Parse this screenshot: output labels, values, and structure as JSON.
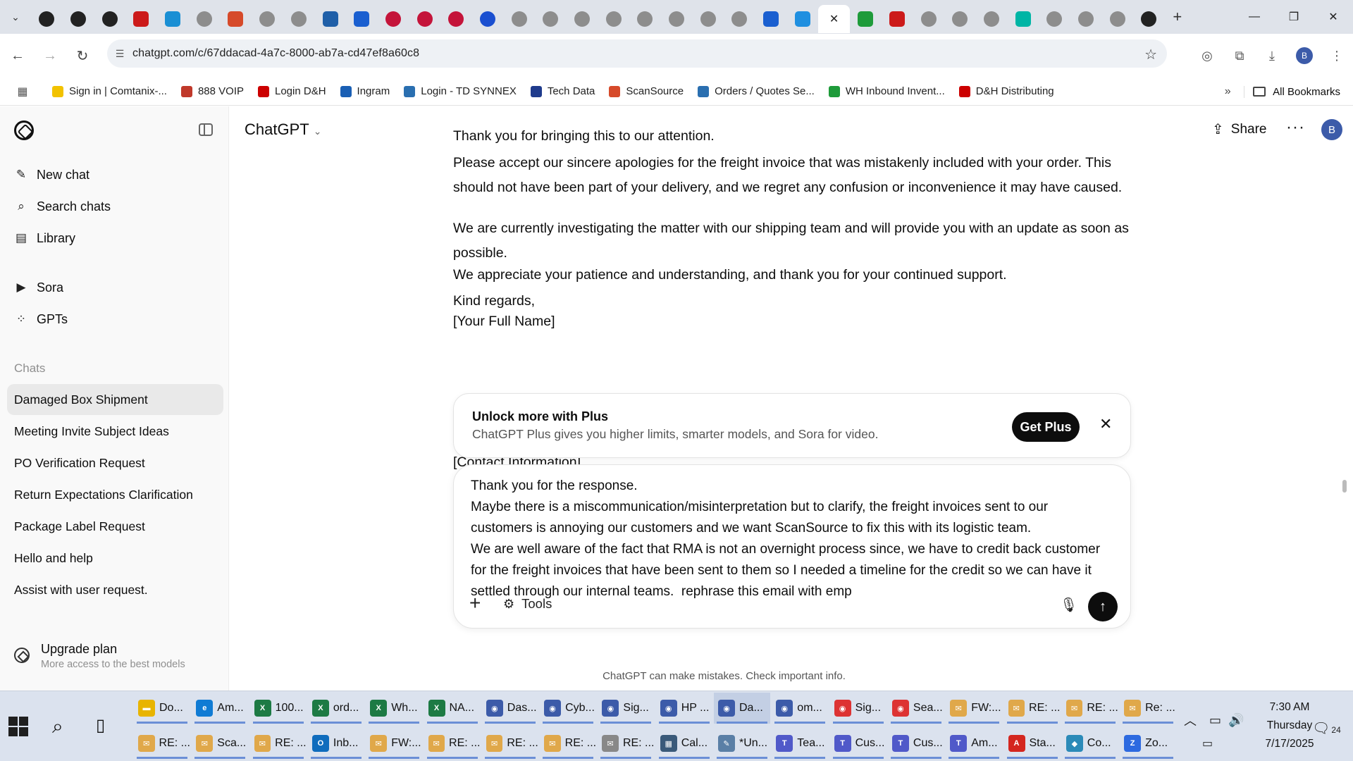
{
  "browser": {
    "active_tab_close": "✕",
    "new_tab": "+",
    "url": "chatgpt.com/c/67ddacad-4a7c-8000-ab7a-cd47ef8a60c8",
    "profile_initial": "B",
    "tab_favicons": [
      "amazon",
      "amazon",
      "amazon",
      "dh",
      "ec",
      "generic",
      "scansource",
      "generic",
      "generic",
      "etn",
      "e",
      "lg",
      "lg",
      "lg",
      "hp",
      "generic",
      "generic",
      "generic",
      "generic",
      "generic",
      "generic",
      "generic",
      "generic",
      "u",
      "cloud",
      "chatgpt",
      "plus",
      "dh",
      "generic",
      "generic",
      "generic",
      "logi",
      "generic",
      "generic",
      "generic",
      "amazon"
    ],
    "bookmarks": [
      {
        "label": "Sign in | Comtanix-...",
        "color": "#f2c200"
      },
      {
        "label": "888 VOIP",
        "color": "#c0392b"
      },
      {
        "label": "Login D&H",
        "color": "#cc0000"
      },
      {
        "label": "Ingram",
        "color": "#1a5fb4"
      },
      {
        "label": "Login - TD SYNNEX",
        "color": "#2a6fb0"
      },
      {
        "label": "Tech Data",
        "color": "#1f3b8c"
      },
      {
        "label": "ScanSource",
        "color": "#d64a2a"
      },
      {
        "label": "Orders / Quotes Se...",
        "color": "#2a6fb0"
      },
      {
        "label": "WH Inbound Invent...",
        "color": "#1e9b3a"
      },
      {
        "label": "D&H Distributing",
        "color": "#cc0000"
      }
    ],
    "all_bookmarks": "All Bookmarks"
  },
  "sidebar": {
    "nav": [
      {
        "icon": "✎",
        "label": "New chat"
      },
      {
        "icon": "⌕",
        "label": "Search chats"
      },
      {
        "icon": "▤",
        "label": "Library"
      },
      {
        "icon": "▶",
        "label": "Sora"
      },
      {
        "icon": "⁘",
        "label": "GPTs"
      }
    ],
    "section_label": "Chats",
    "chats": [
      "Damaged Box Shipment",
      "Meeting Invite Subject Ideas",
      "PO Verification Request",
      "Return Expectations Clarification",
      "Package Label Request",
      "Hello and help",
      "Assist with user request."
    ],
    "upgrade_title": "Upgrade plan",
    "upgrade_sub": "More access to the best models"
  },
  "header": {
    "title": "ChatGPT",
    "share": "Share",
    "avatar": "B"
  },
  "conversation": {
    "p1": "Thank you for bringing this to our attention.",
    "p2": "Please accept our sincere apologies for the freight invoice that was mistakenly included with your order. This should not have been part of your delivery, and we regret any confusion or inconvenience it may have caused.",
    "p3": "We are currently investigating the matter with our shipping team and will provide you with an update as soon as possible.",
    "p4": "We appreciate your patience and understanding, and thank you for your continued support.",
    "p5": "Kind regards,",
    "p6": "[Your Full Name]",
    "p7": "[Contact Information]"
  },
  "upsell": {
    "title": "Unlock more with Plus",
    "subtitle": "ChatGPT Plus gives you higher limits, smarter models, and Sora for video.",
    "button": "Get Plus"
  },
  "composer": {
    "text": "Thank you for the response.\nMaybe there is a miscommunication/misinterpretation but to clarify, the freight invoices sent to our customers is annoying our customers and we want ScanSource to fix this with its logistic team.\nWe are well aware of the fact that RMA is not an overnight process since, we have to credit back customer for the freight invoices that have been sent to them so I needed a timeline for the credit so we can have it settled through our internal teams.  rephrase this email with emp",
    "tools": "Tools"
  },
  "disclaimer": "ChatGPT can make mistakes. Check important info.",
  "taskbar": {
    "row1": [
      {
        "label": "Do...",
        "icon": "folder",
        "color": "#e8b400"
      },
      {
        "label": "Am...",
        "icon": "edge",
        "color": "#0f7bd4"
      },
      {
        "label": "100...",
        "icon": "excel",
        "color": "#1d7a44"
      },
      {
        "label": "ord...",
        "icon": "excel",
        "color": "#1d7a44"
      },
      {
        "label": "Wh...",
        "icon": "excel",
        "color": "#1d7a44"
      },
      {
        "label": "NA...",
        "icon": "excel",
        "color": "#1d7a44"
      },
      {
        "label": "Das...",
        "icon": "chrome",
        "color": "#3c5ba9"
      },
      {
        "label": "Cyb...",
        "icon": "chrome",
        "color": "#3c5ba9"
      },
      {
        "label": "Sig...",
        "icon": "chrome",
        "color": "#3c5ba9"
      },
      {
        "label": "HP ...",
        "icon": "chrome",
        "color": "#3c5ba9"
      },
      {
        "label": "Da...",
        "icon": "chrome",
        "color": "#3c5ba9"
      },
      {
        "label": "om...",
        "icon": "chrome",
        "color": "#3c5ba9"
      },
      {
        "label": "Sig...",
        "icon": "chrome",
        "color": "#d33"
      },
      {
        "label": "Sea...",
        "icon": "chrome",
        "color": "#d33"
      },
      {
        "label": "FW:...",
        "icon": "mail",
        "color": "#e0a84a"
      },
      {
        "label": "RE: ...",
        "icon": "mail",
        "color": "#e0a84a"
      },
      {
        "label": "RE: ...",
        "icon": "mail",
        "color": "#e0a84a"
      },
      {
        "label": "Re: ...",
        "icon": "mail",
        "color": "#e0a84a"
      }
    ],
    "row2": [
      {
        "label": "RE: ...",
        "icon": "mail",
        "color": "#e0a84a"
      },
      {
        "label": "Sca...",
        "icon": "mail",
        "color": "#e0a84a"
      },
      {
        "label": "RE: ...",
        "icon": "mail",
        "color": "#e0a84a"
      },
      {
        "label": "Inb...",
        "icon": "outlook",
        "color": "#0f6cbd"
      },
      {
        "label": "FW:...",
        "icon": "mail",
        "color": "#e0a84a"
      },
      {
        "label": "RE: ...",
        "icon": "mail",
        "color": "#e0a84a"
      },
      {
        "label": "RE: ...",
        "icon": "mail",
        "color": "#e0a84a"
      },
      {
        "label": "RE: ...",
        "icon": "mail",
        "color": "#e0a84a"
      },
      {
        "label": "RE: ...",
        "icon": "mail",
        "color": "#888"
      },
      {
        "label": "Cal...",
        "icon": "calculator",
        "color": "#3a5a7a"
      },
      {
        "label": "*Un...",
        "icon": "notepad",
        "color": "#5a7fa6"
      },
      {
        "label": "Tea...",
        "icon": "teams",
        "color": "#5059c9"
      },
      {
        "label": "Cus...",
        "icon": "teams",
        "color": "#5059c9"
      },
      {
        "label": "Cus...",
        "icon": "teams",
        "color": "#5059c9"
      },
      {
        "label": "Am...",
        "icon": "teams",
        "color": "#5059c9"
      },
      {
        "label": "Sta...",
        "icon": "acrobat",
        "color": "#d4261f"
      },
      {
        "label": "Co...",
        "icon": "app",
        "color": "#2b8ab8"
      },
      {
        "label": "Zo...",
        "icon": "zoom",
        "color": "#2d6ae0"
      }
    ],
    "time": "7:30 AM",
    "day": "Thursday",
    "date": "7/17/2025",
    "notifications": "24"
  }
}
